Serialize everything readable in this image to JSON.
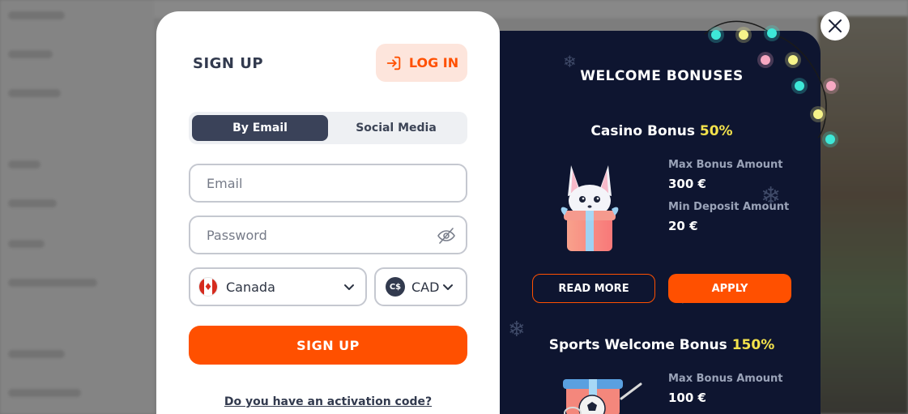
{
  "modal": {
    "signup_title": "SIGN UP",
    "login_label": "LOG IN",
    "tabs": [
      {
        "label": "By Email",
        "active": true
      },
      {
        "label": "Social Media",
        "active": false
      }
    ],
    "email_placeholder": "Email",
    "password_placeholder": "Password",
    "country": {
      "value": "Canada",
      "icon": "canada-flag-icon"
    },
    "currency": {
      "value": "CAD",
      "symbol": "C$"
    },
    "signup_button": "SIGN UP",
    "activation_link": "Do you have an activation code?"
  },
  "bonuses": {
    "title": "WELCOME BONUSES",
    "casino": {
      "name": "Casino Bonus",
      "percent": "50%",
      "max_label": "Max Bonus Amount",
      "max_value": "300 €",
      "min_label": "Min Deposit Amount",
      "min_value": "20 €",
      "read_more": "READ MORE",
      "apply": "APPLY"
    },
    "sports": {
      "name": "Sports Welcome Bonus",
      "percent": "150%",
      "max_label": "Max Bonus Amount",
      "max_value": "100 €"
    }
  },
  "colors": {
    "accent": "#ff5000",
    "panel_bg": "#0e1530",
    "highlight": "#f3e24c",
    "dark_text": "#323a4e"
  }
}
